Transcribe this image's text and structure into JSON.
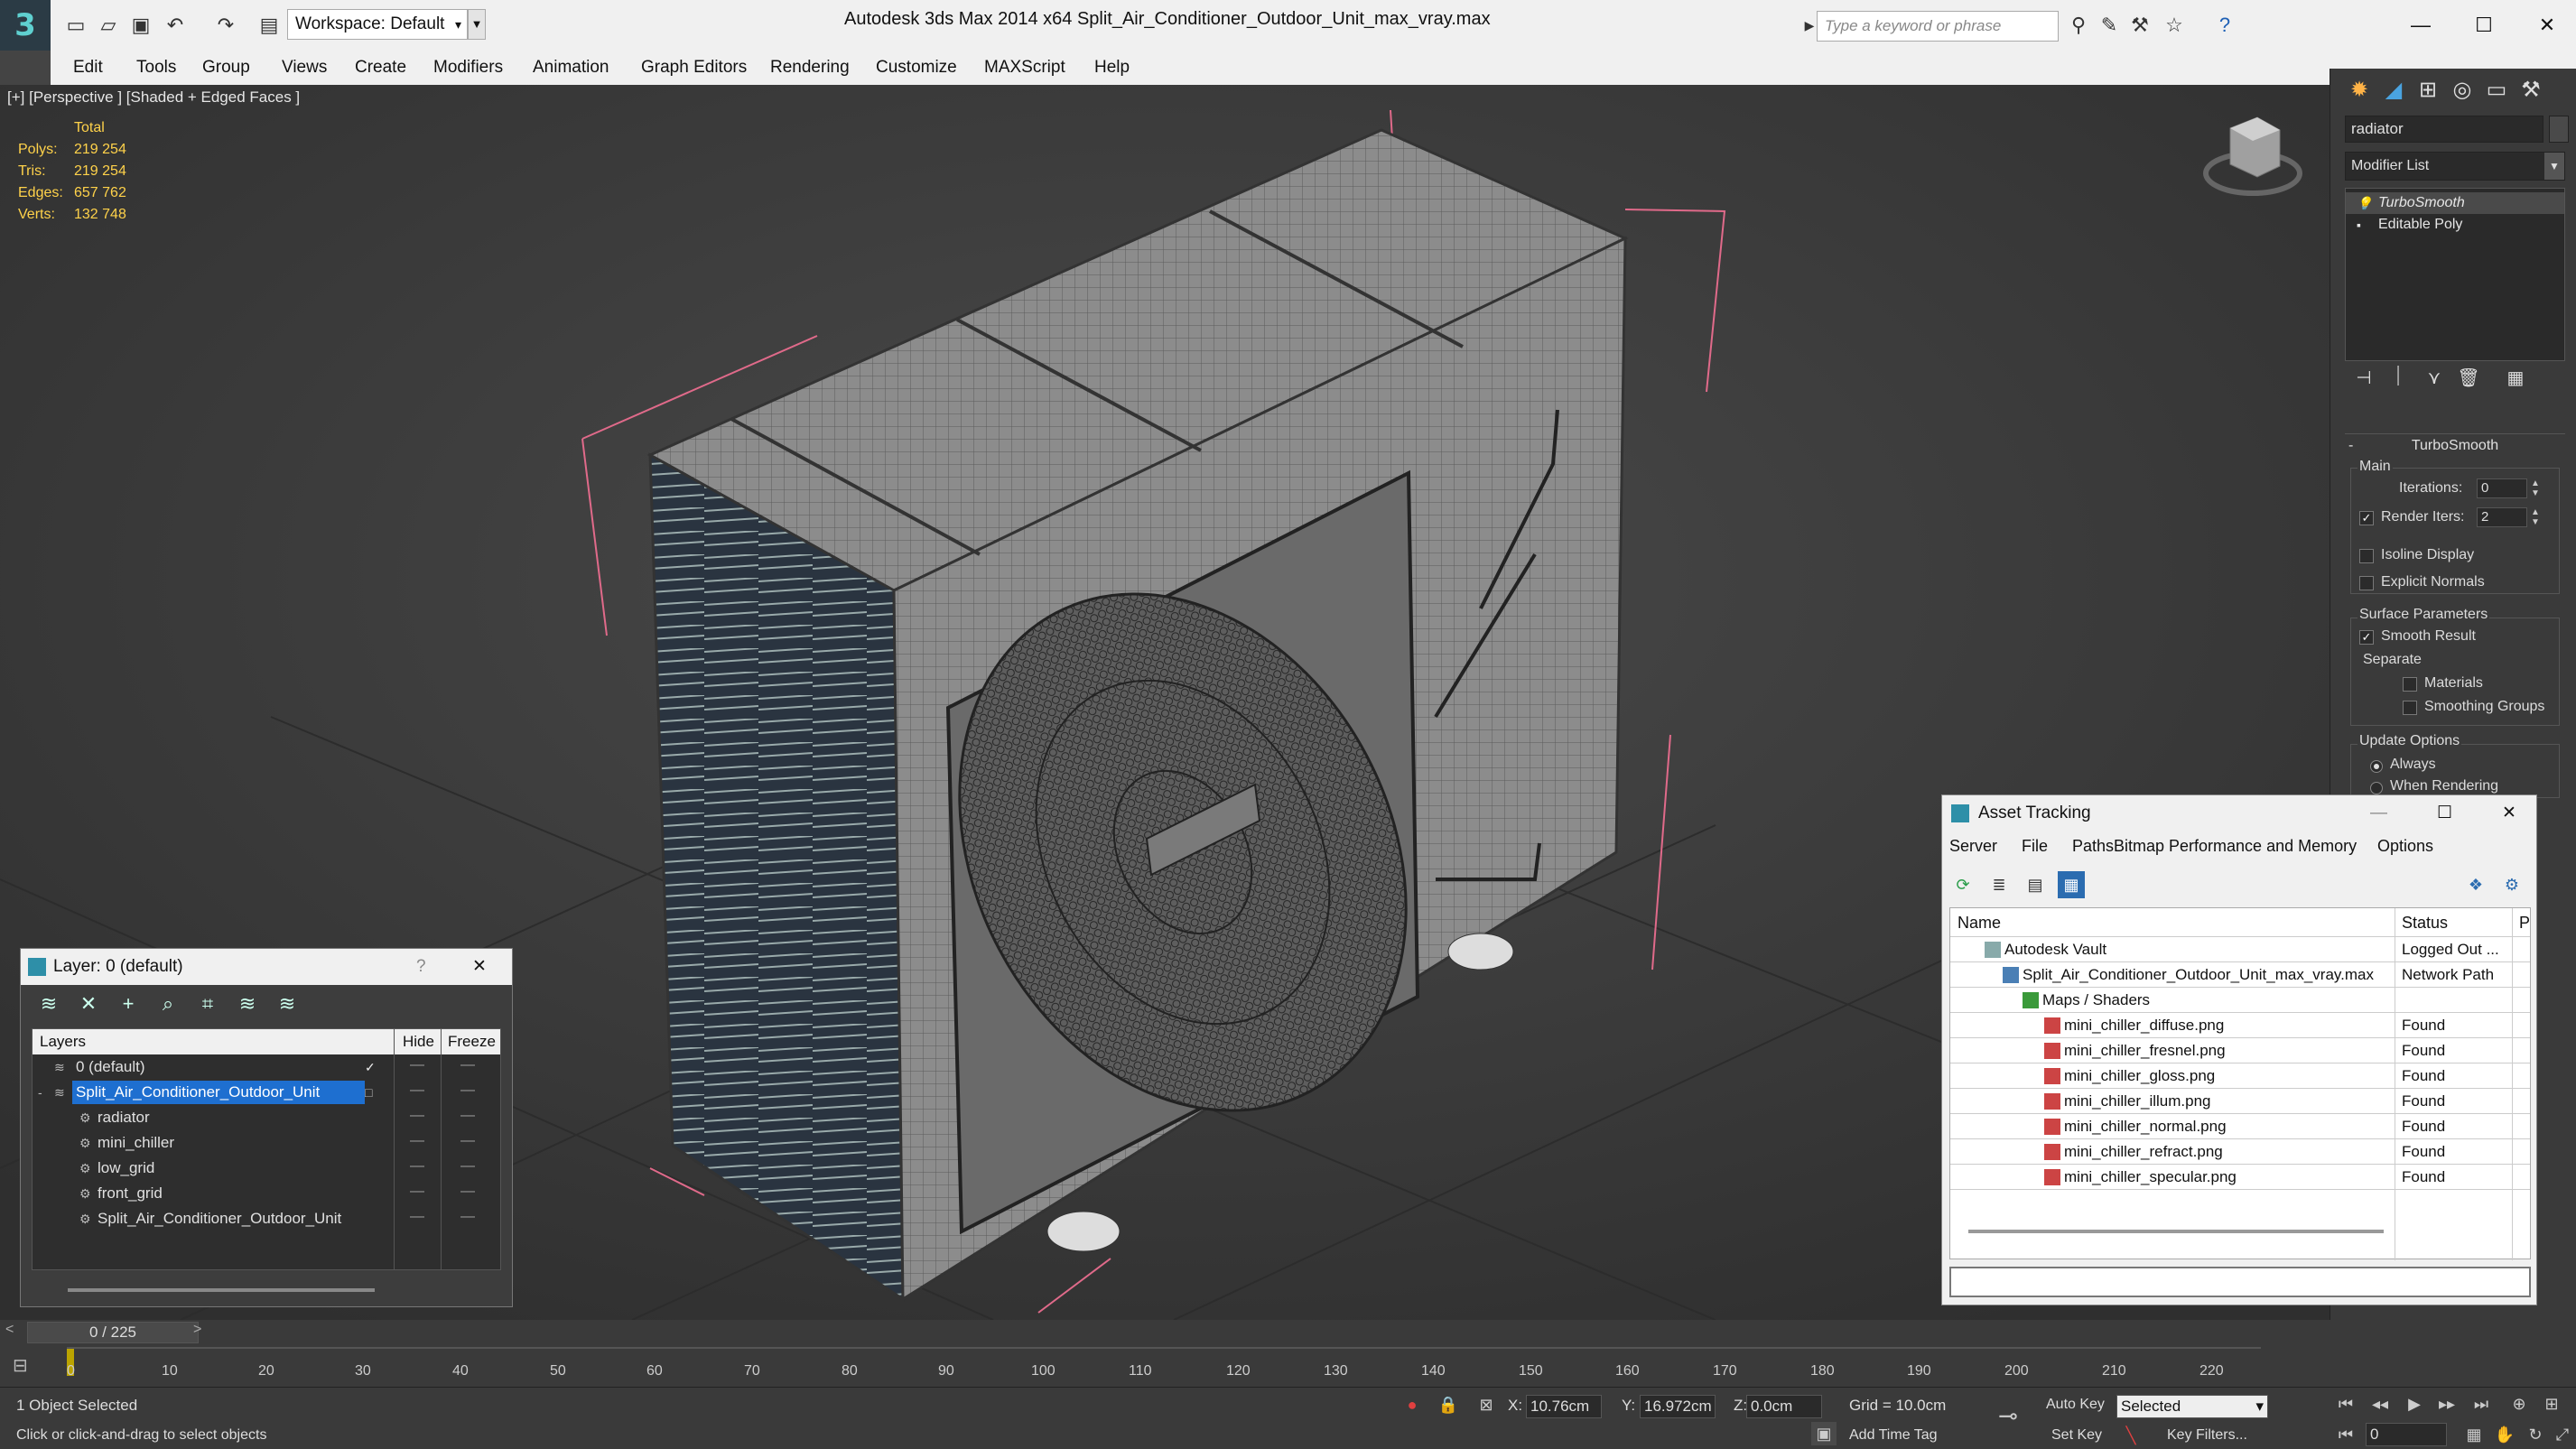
{
  "titlebar": {
    "workspace": "Workspace: Default",
    "app_title": "Autodesk 3ds Max  2014 x64      Split_Air_Conditioner_Outdoor_Unit_max_vray.max",
    "search_placeholder": "Type a keyword or phrase",
    "window_buttons": [
      "—",
      "☐",
      "✕"
    ]
  },
  "menu": [
    "Edit",
    "Tools",
    "Group",
    "Views",
    "Create",
    "Modifiers",
    "Animation",
    "Graph Editors",
    "Rendering",
    "Customize",
    "MAXScript",
    "Help"
  ],
  "viewport": {
    "label": "[+] [Perspective ] [Shaded + Edged Faces ]",
    "stats": {
      "header": "Total",
      "rows": [
        {
          "label": "Polys:",
          "value": "219 254"
        },
        {
          "label": "Tris:",
          "value": "219 254"
        },
        {
          "label": "Edges:",
          "value": "657 762"
        },
        {
          "label": "Verts:",
          "value": "132 748"
        }
      ]
    }
  },
  "command_panel": {
    "object_name": "radiator",
    "modifier_list": "Modifier List",
    "stack": [
      "TurboSmooth",
      "Editable Poly"
    ],
    "turbosmooth": {
      "title": "TurboSmooth",
      "main": "Main",
      "iterations_label": "Iterations:",
      "iterations": "0",
      "render_iters_label": "Render Iters:",
      "render_iters": "2",
      "isoline": "Isoline Display",
      "explicit_normals": "Explicit Normals",
      "surface_params": "Surface Parameters",
      "smooth_result": "Smooth Result",
      "separate": "Separate",
      "materials": "Materials",
      "smoothing_groups": "Smoothing Groups",
      "update_options": "Update Options",
      "always": "Always",
      "when_rendering": "When Rendering"
    }
  },
  "layer_dialog": {
    "title": "Layer: 0 (default)",
    "help": "?",
    "close": "✕",
    "columns": [
      "Layers",
      "Hide",
      "Freeze"
    ],
    "rows": [
      {
        "name": "0 (default)",
        "indent": 0,
        "selected": false,
        "check": "✓"
      },
      {
        "name": "Split_Air_Conditioner_Outdoor_Unit",
        "indent": 0,
        "selected": true,
        "check": "□"
      },
      {
        "name": "radiator",
        "indent": 1,
        "selected": false,
        "check": ""
      },
      {
        "name": "mini_chiller",
        "indent": 1,
        "selected": false,
        "check": ""
      },
      {
        "name": "low_grid",
        "indent": 1,
        "selected": false,
        "check": ""
      },
      {
        "name": "front_grid",
        "indent": 1,
        "selected": false,
        "check": ""
      },
      {
        "name": "Split_Air_Conditioner_Outdoor_Unit",
        "indent": 1,
        "selected": false,
        "check": ""
      }
    ]
  },
  "asset_tracking": {
    "title": "Asset Tracking",
    "menu": [
      "Server",
      "File",
      "Paths",
      "Bitmap Performance and Memory",
      "Options"
    ],
    "columns": [
      "Name",
      "Status",
      "P"
    ],
    "rows": [
      {
        "name": "Autodesk Vault",
        "status": "Logged Out ...",
        "indent": 1,
        "icon": "vault"
      },
      {
        "name": "Split_Air_Conditioner_Outdoor_Unit_max_vray.max",
        "status": "Network Path",
        "indent": 2,
        "icon": "max"
      },
      {
        "name": "Maps / Shaders",
        "status": "",
        "indent": 3,
        "icon": "folder"
      },
      {
        "name": "mini_chiller_diffuse.png",
        "status": "Found",
        "indent": 4,
        "icon": "png"
      },
      {
        "name": "mini_chiller_fresnel.png",
        "status": "Found",
        "indent": 4,
        "icon": "png"
      },
      {
        "name": "mini_chiller_gloss.png",
        "status": "Found",
        "indent": 4,
        "icon": "png"
      },
      {
        "name": "mini_chiller_illum.png",
        "status": "Found",
        "indent": 4,
        "icon": "png"
      },
      {
        "name": "mini_chiller_normal.png",
        "status": "Found",
        "indent": 4,
        "icon": "png"
      },
      {
        "name": "mini_chiller_refract.png",
        "status": "Found",
        "indent": 4,
        "icon": "png"
      },
      {
        "name": "mini_chiller_specular.png",
        "status": "Found",
        "indent": 4,
        "icon": "png"
      }
    ]
  },
  "timeline": {
    "slider": "0 / 225",
    "ticks": [
      "0",
      "10",
      "20",
      "30",
      "40",
      "50",
      "60",
      "70",
      "80",
      "90",
      "100",
      "110",
      "120",
      "130",
      "140",
      "150",
      "160",
      "170",
      "180",
      "190",
      "200",
      "210",
      "220"
    ]
  },
  "status": {
    "selected": "1 Object Selected",
    "prompt": "Click or click-and-drag to select objects",
    "x_label": "X:",
    "x": "10.76cm",
    "y_label": "Y:",
    "y": "16.972cm",
    "z_label": "Z:",
    "z": "0.0cm",
    "grid": "Grid = 10.0cm",
    "add_time_tag": "Add Time Tag",
    "auto_key": "Auto Key",
    "selected_mode": "Selected",
    "set_key": "Set Key",
    "key_filters": "Key Filters...",
    "frame": "0"
  }
}
